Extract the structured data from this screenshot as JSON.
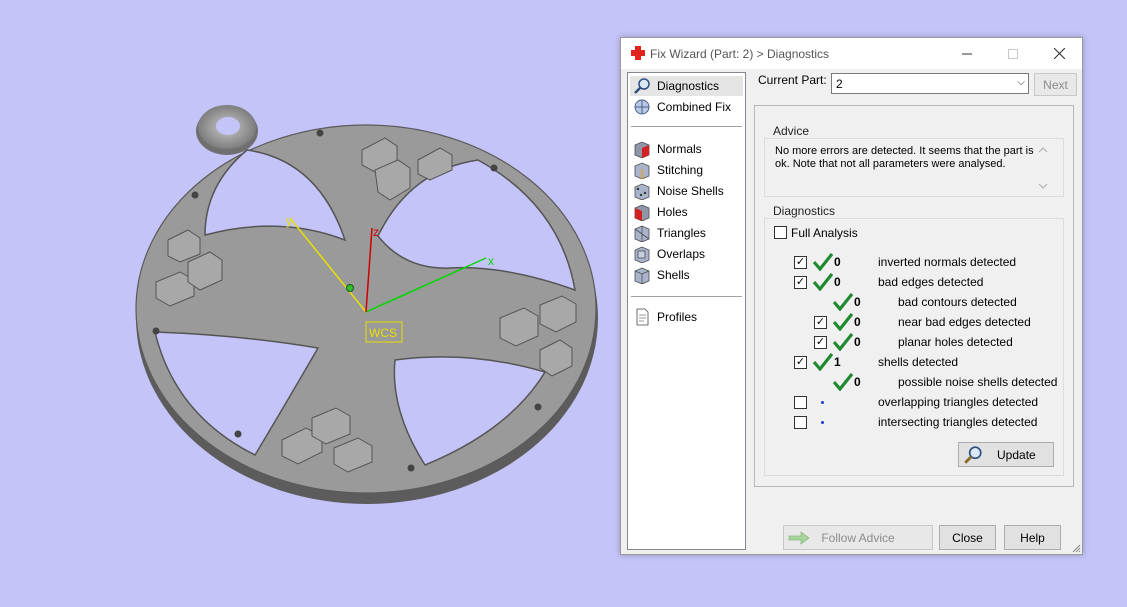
{
  "viewport": {
    "axis_labels": {
      "x": "x",
      "y": "y",
      "z": "z"
    },
    "wcs_label": "WCS"
  },
  "dialog": {
    "title": "Fix Wizard (Part: 2) > Diagnostics",
    "nav": {
      "top": [
        {
          "label": "Diagnostics",
          "icon": "magnifier-icon",
          "selected": true
        },
        {
          "label": "Combined Fix",
          "icon": "combined-fix-icon"
        }
      ],
      "tools": [
        {
          "label": "Normals",
          "icon": "normals-icon"
        },
        {
          "label": "Stitching",
          "icon": "stitching-icon"
        },
        {
          "label": "Noise Shells",
          "icon": "noise-shells-icon"
        },
        {
          "label": "Holes",
          "icon": "holes-icon"
        },
        {
          "label": "Triangles",
          "icon": "triangles-icon"
        },
        {
          "label": "Overlaps",
          "icon": "overlaps-icon"
        },
        {
          "label": "Shells",
          "icon": "shells-icon"
        }
      ],
      "bottom": [
        {
          "label": "Profiles",
          "icon": "profiles-icon"
        }
      ]
    },
    "current_part_label": "Current Part:",
    "current_part_value": "2",
    "next_label": "Next",
    "advice": {
      "title": "Advice",
      "text": "No more errors are detected. It seems that the part is ok. Note that not all parameters were analysed."
    },
    "diagnostics": {
      "title": "Diagnostics",
      "full_analysis_label": "Full Analysis",
      "full_analysis_checked": false,
      "rows": [
        {
          "checkbox": true,
          "checked": true,
          "status": "ok",
          "count": "0",
          "label": "inverted normals detected",
          "indent": 0
        },
        {
          "checkbox": true,
          "checked": true,
          "status": "ok",
          "count": "0",
          "label": "bad edges detected",
          "indent": 0
        },
        {
          "checkbox": false,
          "checked": false,
          "status": "ok",
          "count": "0",
          "label": "bad contours detected",
          "indent": 1
        },
        {
          "checkbox": true,
          "checked": true,
          "status": "ok",
          "count": "0",
          "label": "near bad edges detected",
          "indent": 1
        },
        {
          "checkbox": true,
          "checked": true,
          "status": "ok",
          "count": "0",
          "label": "planar holes detected",
          "indent": 1
        },
        {
          "checkbox": true,
          "checked": true,
          "status": "ok",
          "count": "1",
          "label": "shells detected",
          "indent": 0
        },
        {
          "checkbox": false,
          "checked": false,
          "status": "ok",
          "count": "0",
          "label": "possible noise shells detected",
          "indent": 1
        },
        {
          "checkbox": true,
          "checked": false,
          "status": "unknown",
          "count": "",
          "label": "overlapping triangles detected",
          "indent": 0
        },
        {
          "checkbox": true,
          "checked": false,
          "status": "unknown",
          "count": "",
          "label": "intersecting triangles detected",
          "indent": 0
        }
      ],
      "update_label": "Update"
    },
    "buttons": {
      "follow_advice": "Follow Advice",
      "close": "Close",
      "help": "Help"
    }
  },
  "colors": {
    "background": "#c4c4f8",
    "model": "#8e8e8e",
    "check_green": "#1e8a2e",
    "axis_x": "#00d800",
    "axis_y": "#e8e000",
    "axis_z": "#d00000"
  }
}
